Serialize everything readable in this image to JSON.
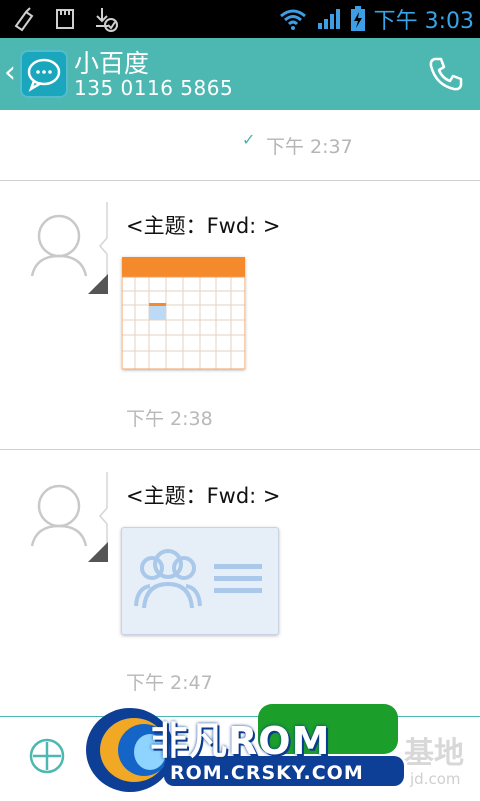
{
  "status_bar": {
    "time": "下午 3:03",
    "icons": [
      "usb-debug-icon",
      "sd-card-icon",
      "download-icon",
      "wifi-icon",
      "signal-icon",
      "battery-charging-icon"
    ]
  },
  "header": {
    "contact_name": "小百度",
    "contact_number": "135 0116 5865",
    "back_icon": "chevron-left-icon",
    "app_icon": "chat-bubble-icon",
    "call_icon": "phone-icon"
  },
  "thread": {
    "sent_time": "下午 2:37",
    "messages": [
      {
        "subject": "<主题：Fwd: >",
        "attachment": "calendar-attachment",
        "time": "下午 2:38"
      },
      {
        "subject": "<主题：Fwd: >",
        "attachment": "contact-card-attachment",
        "time": "下午 2:47"
      }
    ]
  },
  "composer": {
    "add_icon": "add-circle-icon"
  },
  "watermark": {
    "brand": "非凡ROM",
    "url": "ROM.CRSKY.COM",
    "suffix": "基地",
    "suffix2": "jd.com"
  }
}
